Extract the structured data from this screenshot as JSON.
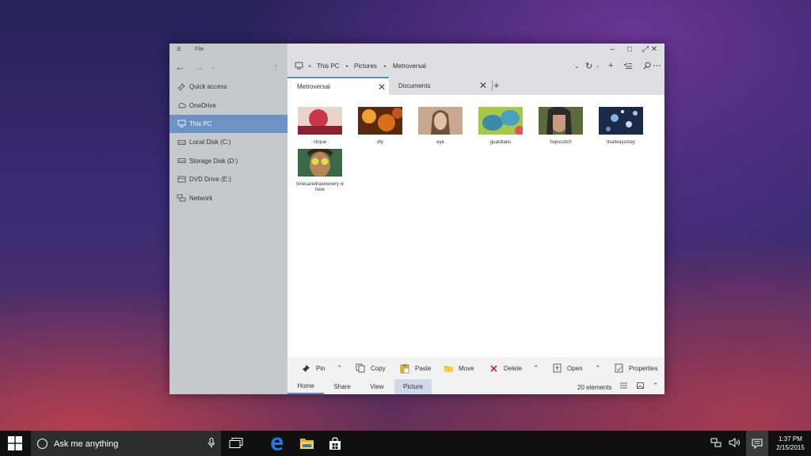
{
  "window": {
    "title_menu": "File",
    "breadcrumb": [
      "This PC",
      "Pictures",
      "Metroversal"
    ],
    "tabs": [
      {
        "label": "Metroversal",
        "active": true
      },
      {
        "label": "Documents",
        "active": false
      }
    ]
  },
  "sidebar": {
    "items": [
      {
        "label": "Quick access",
        "icon": "pin-icon"
      },
      {
        "label": "OneDrive",
        "icon": "cloud-icon"
      },
      {
        "label": "This PC",
        "icon": "computer-icon",
        "active": true
      },
      {
        "label": "Local Disk (C:)",
        "icon": "drive-icon"
      },
      {
        "label": "Storage Disk (D:)",
        "icon": "drive-icon"
      },
      {
        "label": "DVD Drive (E:)",
        "icon": "dvd-icon"
      },
      {
        "label": "Network",
        "icon": "network-icon"
      }
    ]
  },
  "files": [
    {
      "name": "cirque",
      "colors": [
        "#c8384a",
        "#e8d4c8"
      ]
    },
    {
      "name": "dly",
      "colors": [
        "#c0541a",
        "#f0a030"
      ]
    },
    {
      "name": "eye",
      "colors": [
        "#5a3a28",
        "#d9b89a"
      ]
    },
    {
      "name": "guardians",
      "colors": [
        "#3a8aa8",
        "#a8c848"
      ]
    },
    {
      "name": "hopscotch",
      "colors": [
        "#2a2a2a",
        "#c89a80"
      ]
    },
    {
      "name": "itsalwaysmay",
      "colors": [
        "#1a2a48",
        "#8ab0e0"
      ]
    },
    {
      "name": "limesaredrawnevery where",
      "colors": [
        "#3a6a48",
        "#c8a048"
      ]
    }
  ],
  "commands": {
    "pin": "Pin",
    "copy": "Copy",
    "paste": "Paste",
    "move": "Move",
    "delete": "Delete",
    "open": "Open",
    "properties": "Properties"
  },
  "ribbon": {
    "tabs": [
      "Home",
      "Share",
      "View",
      "Picture"
    ],
    "status": "20 elements"
  },
  "taskbar": {
    "search_text": "Ask me anything",
    "time": "1:37 PM",
    "date": "2/15/2015"
  },
  "colors": {
    "accent": "#6b93c3",
    "sidebar_bg": "#c7c8cc",
    "chrome_bg": "#dfdfe1",
    "taskbar_bg": "#101010"
  }
}
